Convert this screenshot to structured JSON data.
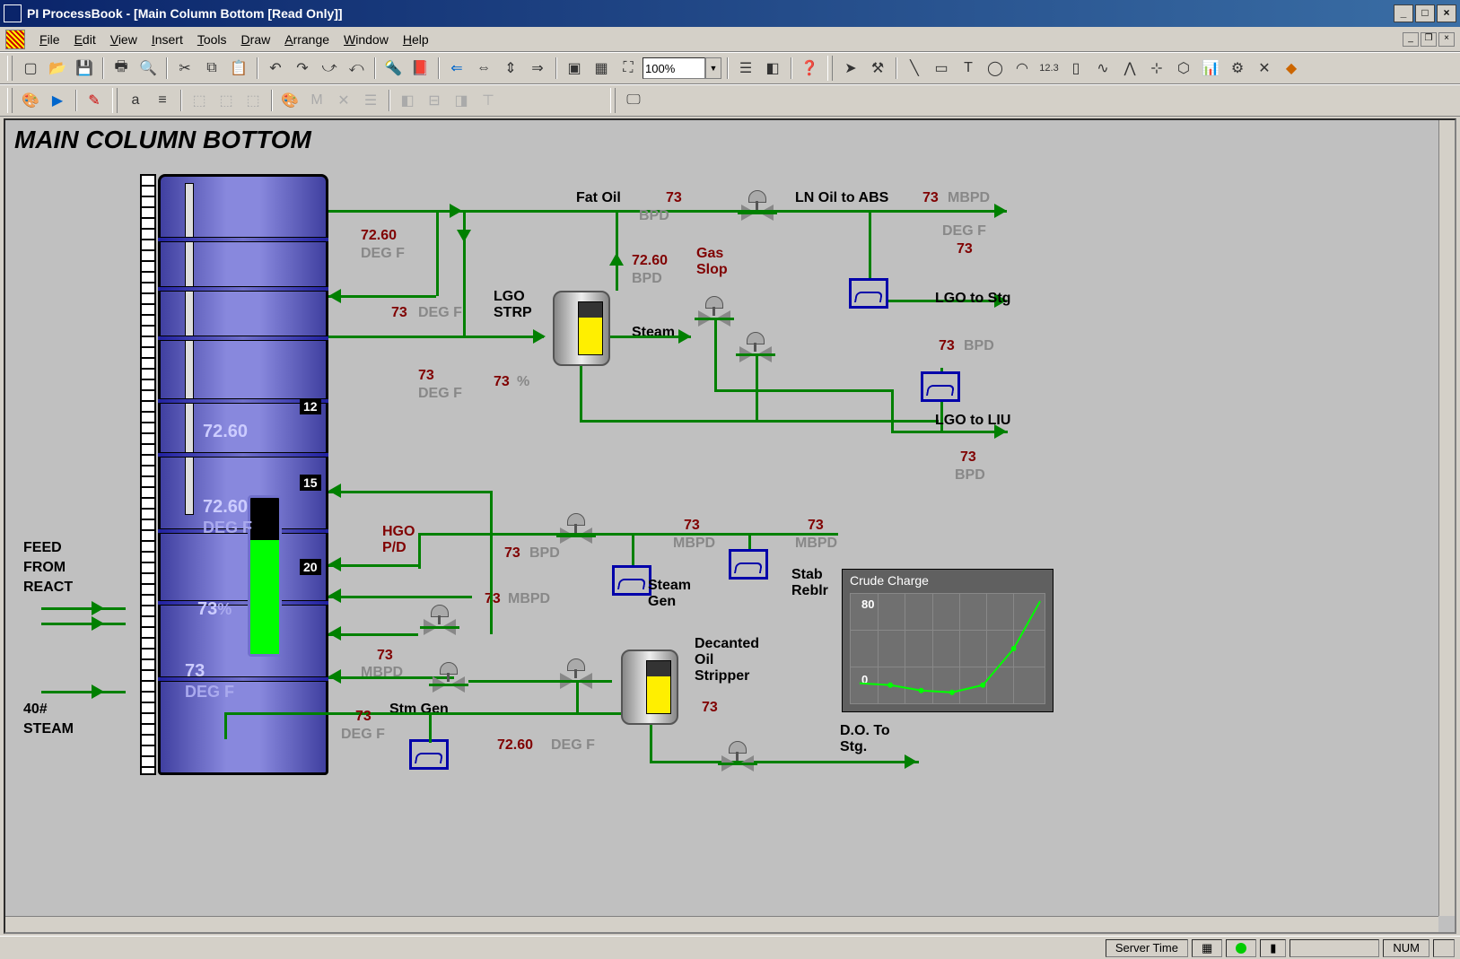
{
  "app": {
    "title": "PI ProcessBook - [Main Column Bottom [Read Only]]"
  },
  "menu": [
    "File",
    "Edit",
    "View",
    "Insert",
    "Tools",
    "Draw",
    "Arrange",
    "Window",
    "Help"
  ],
  "zoom": "100%",
  "display": {
    "title": "MAIN COLUMN BOTTOM"
  },
  "feed": {
    "line1": "FEED",
    "line2": "FROM",
    "line3": "REACT"
  },
  "steam_in": {
    "line1": "40#",
    "line2": "STEAM"
  },
  "column": {
    "tray12": "12",
    "tray15": "15",
    "tray20": "20",
    "t_top": "72.60",
    "t_mid": "72.60",
    "t_mid_unit": "DEG F",
    "level": "73",
    "level_unit": "%",
    "t_bot": "73",
    "t_bot_unit": "DEG F"
  },
  "right1": {
    "v": "72.60",
    "u": "DEG F"
  },
  "right2": {
    "v": "73",
    "u": "DEG F"
  },
  "right3": {
    "v": "73",
    "u": "DEG F"
  },
  "fat_oil": {
    "label": "Fat Oil",
    "v": "73",
    "u": "BPD"
  },
  "lgo_in": {
    "v": "72.60",
    "u": "BPD"
  },
  "lgo_strp": "LGO\nSTRP",
  "steam": "Steam",
  "strp_pct": {
    "v": "73",
    "u": "%"
  },
  "gas_slop": "Gas\nSlop",
  "ln_oil": {
    "label": "LN Oil to ABS",
    "v": "73",
    "u": "MBPD",
    "u2": "DEG F",
    "v2": "73"
  },
  "lgo_stg": {
    "label": "LGO to Stg",
    "v": "73",
    "u": "BPD"
  },
  "lgo_liu": {
    "label": "LGO to LIU",
    "v": "73",
    "u": "BPD"
  },
  "hgo": "HGO\nP/D",
  "hgo_bpd": {
    "v": "73",
    "u": "BPD"
  },
  "hgo_mbpd": {
    "v": "73",
    "u": "MBPD"
  },
  "draw_mbpd": {
    "v": "73",
    "u": "MBPD"
  },
  "steam_gen": {
    "label": "Steam\nGen",
    "v": "73",
    "u": "MBPD"
  },
  "stab": {
    "label": "Stab\nReblr",
    "v": "73",
    "u": "MBPD"
  },
  "stm_gen2": "Stm Gen",
  "bot_t": {
    "v": "73",
    "u": "DEG F"
  },
  "dec_t": {
    "v": "72.60",
    "u": "DEG F"
  },
  "decanted": {
    "label": "Decanted\nOil\nStripper",
    "v": "73"
  },
  "do_stg": "D.O. To\nStg.",
  "trend": {
    "title": "Crude Charge",
    "y0": "0",
    "y1": "80"
  },
  "status": {
    "server": "Server Time",
    "num": "NUM"
  },
  "chart_data": {
    "type": "line",
    "title": "Crude Charge",
    "ylim": [
      0,
      80
    ],
    "x": [
      0,
      1,
      2,
      3,
      4,
      5,
      6
    ],
    "values": [
      5,
      2,
      -3,
      -5,
      2,
      30,
      78
    ]
  }
}
